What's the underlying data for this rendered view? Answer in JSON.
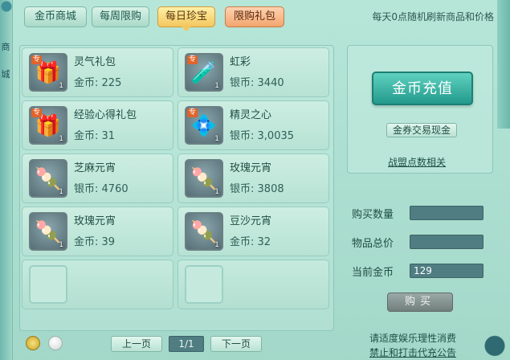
{
  "tabs": [
    {
      "label": "金币商城",
      "state": "normal"
    },
    {
      "label": "每周限购",
      "state": "normal"
    },
    {
      "label": "每日珍宝",
      "state": "active"
    },
    {
      "label": "限购礼包",
      "state": "gift"
    }
  ],
  "refresh_note": "每天0点随机刷新商品和价格",
  "side_chars": [
    "商",
    "城"
  ],
  "items": [
    {
      "name": "灵气礼包",
      "price_label": "金币:",
      "price": "225",
      "qty": "1",
      "special": "专",
      "icon": "gift-bag-icon"
    },
    {
      "name": "虹彩",
      "price_label": "银币:",
      "price": "3440",
      "qty": "1",
      "special": "专",
      "icon": "potion-bottle-icon"
    },
    {
      "name": "经验心得礼包",
      "price_label": "金币:",
      "price": "31",
      "qty": "1",
      "special": "专",
      "icon": "gift-bag-icon"
    },
    {
      "name": "精灵之心",
      "price_label": "银币:",
      "price": "3,0035",
      "qty": "1",
      "special": "专",
      "icon": "spirit-heart-icon"
    },
    {
      "name": "芝麻元宵",
      "price_label": "银币:",
      "price": "4760",
      "qty": "1",
      "special": "",
      "icon": "sesame-dumplings-icon"
    },
    {
      "name": "玫瑰元宵",
      "price_label": "银币:",
      "price": "3808",
      "qty": "1",
      "special": "",
      "icon": "rose-dumplings-icon"
    },
    {
      "name": "玫瑰元宵",
      "price_label": "金币:",
      "price": "39",
      "qty": "1",
      "special": "",
      "icon": "rose-dumplings-icon"
    },
    {
      "name": "豆沙元宵",
      "price_label": "金币:",
      "price": "32",
      "qty": "1",
      "special": "",
      "icon": "bean-paste-dumplings-icon"
    }
  ],
  "right_panel": {
    "recharge_label": "金币充值",
    "voucher_trade_label": "金券交易现金",
    "alliance_link": "战盟点数相关"
  },
  "purchase": {
    "quantity_label": "购买数量",
    "quantity_value": "",
    "total_label": "物品总价",
    "total_value": "",
    "current_gold_label": "当前金币",
    "current_gold_value": "129",
    "buy_label": "购买"
  },
  "pagination": {
    "prev_label": "上一页",
    "page_indicator": "1/1",
    "next_label": "下一页"
  },
  "notices": {
    "line1": "请适度娱乐理性消费",
    "line2": "禁止和打击代充公告"
  }
}
